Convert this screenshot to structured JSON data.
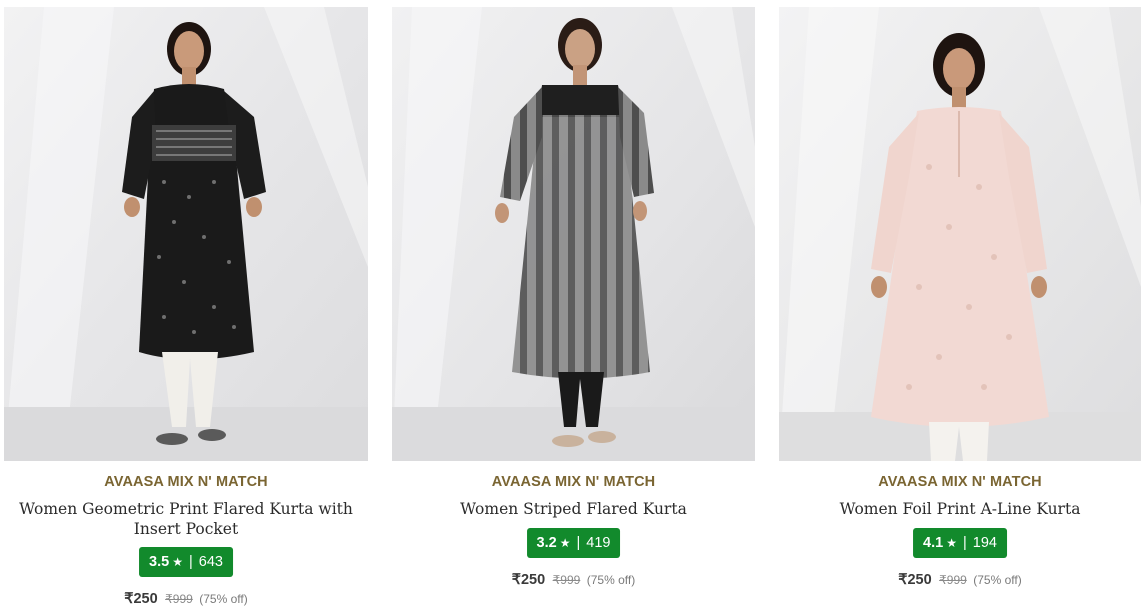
{
  "currency": "₹",
  "colors": {
    "brand": "#7a6532",
    "rating_bg": "#128a2c"
  },
  "products": [
    {
      "brand": "AVAASA MIX N' MATCH",
      "title": "Women Geometric Print Flared Kurta with Insert Pocket",
      "rating": "3.5",
      "star": "★",
      "reviews": "643",
      "price": "₹250",
      "mrp": "₹999",
      "discount": "(75% off)",
      "image": "woman in black geometric print flared kurta with white pants"
    },
    {
      "brand": "AVAASA MIX N' MATCH",
      "title": "Women Striped Flared Kurta",
      "rating": "3.2",
      "star": "★",
      "reviews": "419",
      "price": "₹250",
      "mrp": "₹999",
      "discount": "(75% off)",
      "image": "woman in grey striped sheer flared kurta with black leggings"
    },
    {
      "brand": "AVAASA MIX N' MATCH",
      "title": "Women Foil Print A-Line Kurta",
      "rating": "4.1",
      "star": "★",
      "reviews": "194",
      "price": "₹250",
      "mrp": "₹999",
      "discount": "(75% off)",
      "image": "woman in pale pink foil print A-line kurta with white pants"
    }
  ]
}
